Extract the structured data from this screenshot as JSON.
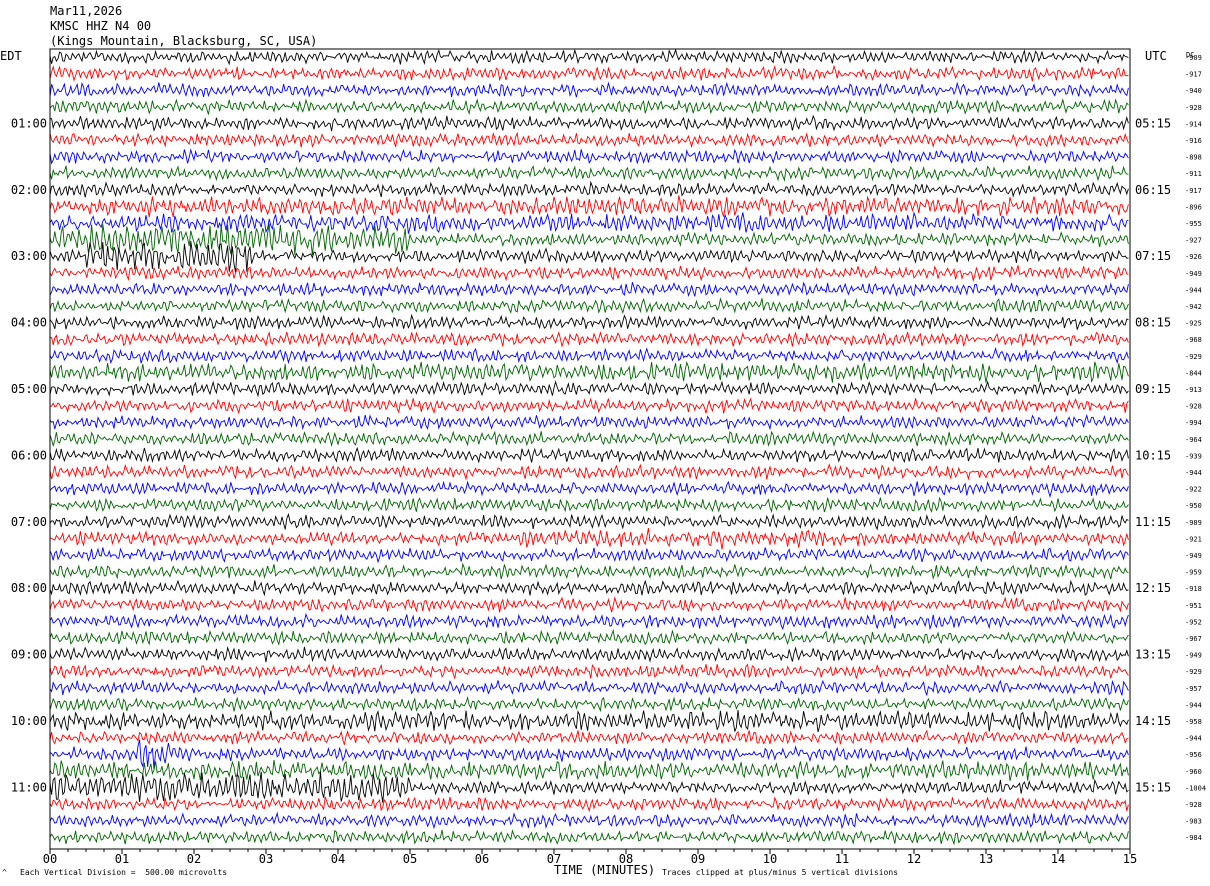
{
  "header": {
    "date": "Mar11,2026",
    "station": "KMSC HHZ N4 00",
    "location": "(Kings Mountain, Blacksburg, SC, USA)"
  },
  "axes": {
    "left_tz": "EDT",
    "right_tz": "UTC",
    "dc_label": "DC",
    "x_title": "TIME (MINUTES)",
    "left_times": [
      "01:00",
      "02:00",
      "03:00",
      "04:00",
      "05:00",
      "06:00",
      "07:00",
      "08:00",
      "09:00",
      "10:00",
      "11:00"
    ],
    "right_times": [
      "05:15",
      "06:15",
      "07:15",
      "08:15",
      "09:15",
      "10:15",
      "11:15",
      "12:15",
      "13:15",
      "14:15",
      "15:15"
    ],
    "x_ticks": [
      "00",
      "01",
      "02",
      "03",
      "04",
      "05",
      "06",
      "07",
      "08",
      "09",
      "10",
      "11",
      "12",
      "13",
      "14",
      "15"
    ]
  },
  "footer": {
    "left_mark": "^",
    "scale_note": "Each Vertical Division =  500.00 microvolts",
    "clip_note": "Traces clipped at plus/minus 5 vertical divisions"
  },
  "colors": {
    "trace_cycle": [
      "#000000",
      "#ff0000",
      "#0000ff",
      "#006400"
    ]
  },
  "chart_data": {
    "type": "line",
    "title": "KMSC HHZ N4 00",
    "xlabel": "TIME (MINUTES)",
    "xlim": [
      0,
      15
    ],
    "line_minutes": 15,
    "dc_offsets": [
      -909,
      -917,
      -940,
      -928,
      -914,
      -916,
      -898,
      -911,
      -917,
      -896,
      -955,
      -927,
      -926,
      -949,
      -944,
      -942,
      -925,
      -968,
      -929,
      -844,
      -913,
      -928,
      -994,
      -964,
      -939,
      -944,
      -922,
      -950,
      -989,
      -921,
      -949,
      -959,
      -918,
      -951,
      -952,
      -967,
      -949,
      -929,
      -957,
      -944,
      -958,
      -944,
      -956,
      -960,
      -1004,
      -928,
      -983,
      -984
    ],
    "event_spans": [
      {
        "row": 9,
        "start": 0.5,
        "end": 15,
        "level": "elevated"
      },
      {
        "row": 10,
        "start": 0,
        "end": 15,
        "level": "elevated"
      },
      {
        "row": 11,
        "start": 0,
        "end": 5,
        "level": "strong"
      },
      {
        "row": 12,
        "start": 0.5,
        "end": 2.8,
        "level": "strong"
      },
      {
        "row": 19,
        "start": 0,
        "end": 15,
        "level": "elevated"
      },
      {
        "row": 29,
        "start": 6.5,
        "end": 11,
        "level": "elevated"
      },
      {
        "row": 40,
        "start": 0,
        "end": 15,
        "level": "elevated"
      },
      {
        "row": 42,
        "start": 1.2,
        "end": 1.8,
        "level": "strong"
      },
      {
        "row": 43,
        "start": 0,
        "end": 15,
        "level": "elevated"
      },
      {
        "row": 44,
        "start": 0,
        "end": 5,
        "level": "strong"
      }
    ]
  }
}
